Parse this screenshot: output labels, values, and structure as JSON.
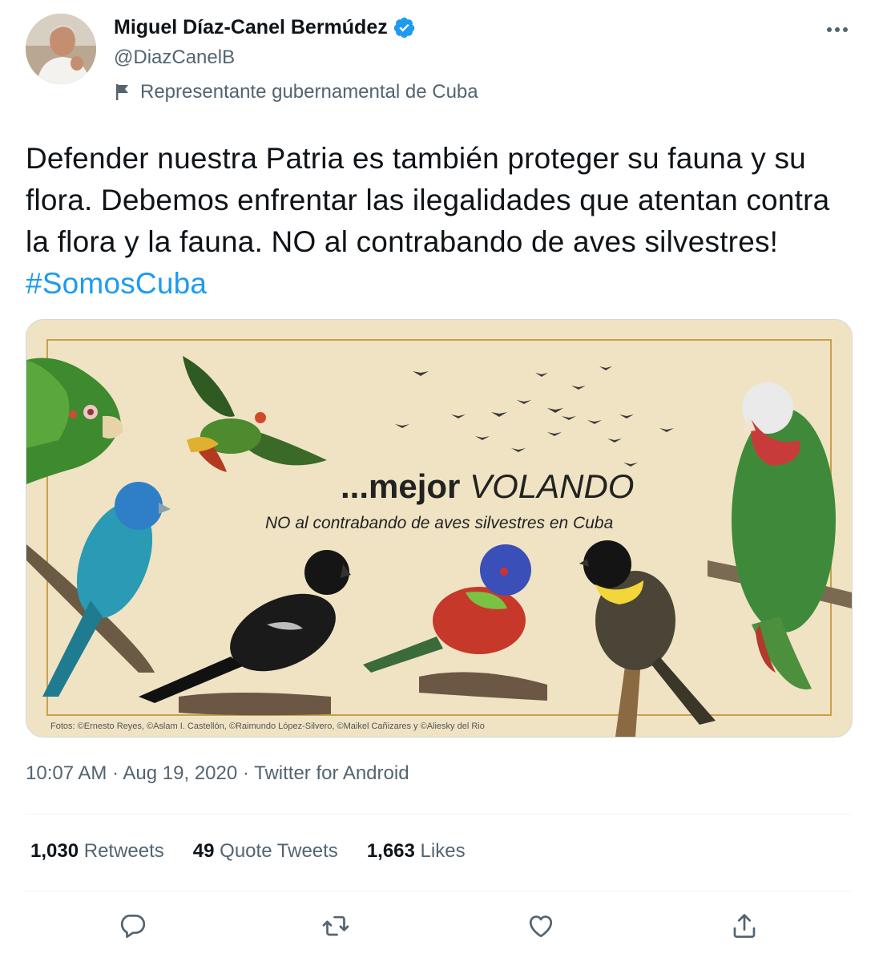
{
  "author": {
    "name": "Miguel Díaz-Canel Bermúdez",
    "handle": "@DiazCanelB",
    "label": "Representante gubernamental de Cuba"
  },
  "tweet": {
    "text": "Defender nuestra Patria es también proteger su fauna y su flora.  Debemos enfrentar las ilegalidades que atentan contra la flora y la fauna. NO al contrabando de aves silvestres! ",
    "hashtag": "#SomosCuba"
  },
  "media": {
    "headline_prefix": "...mejor ",
    "headline_emphasis": "VOLANDO",
    "subtitle": "NO al contrabando de aves silvestres en Cuba",
    "credits": "Fotos: ©Ernesto Reyes, ©Aslam I. Castellón, ©Raimundo López-Silvero, ©Maikel Cañizares y ©Aliesky del Rio"
  },
  "meta": {
    "time": "10:07 AM",
    "date": "Aug 19, 2020",
    "source": "Twitter for Android",
    "separator": " · "
  },
  "stats": {
    "retweets_count": "1,030",
    "retweets_label": "Retweets",
    "quotes_count": "49",
    "quotes_label": "Quote Tweets",
    "likes_count": "1,663",
    "likes_label": "Likes"
  },
  "icons": [
    "verified-badge-icon",
    "flag-icon",
    "more-icon",
    "reply-icon",
    "retweet-icon",
    "like-icon",
    "share-icon"
  ],
  "colors": {
    "link": "#1d9bf0",
    "verified": "#1d9bf0",
    "secondary_text": "#536471",
    "media_background": "#efe3c3"
  }
}
